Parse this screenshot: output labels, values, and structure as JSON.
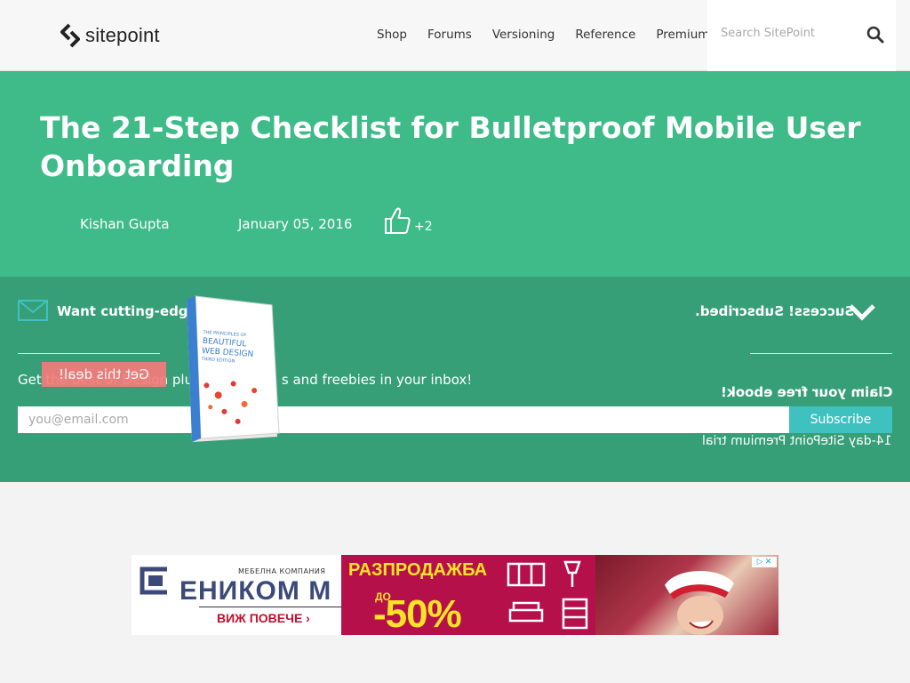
{
  "header": {
    "logo_text": "sitepoint",
    "nav": [
      "Shop",
      "Forums",
      "Versioning",
      "Reference",
      "Premium"
    ],
    "search_placeholder": "Search SitePoint"
  },
  "article": {
    "title": "The 21-Step Checklist for Bulletproof Mobile User Onboarding",
    "author": "Kishan Gupta",
    "date": "January 05, 2016",
    "likes": "+2"
  },
  "newsletter": {
    "heading": "Want cutting-edge",
    "description": "Get the best of Design plus",
    "description_tail": "s and freebies in your inbox!",
    "email_placeholder": "you@email.com",
    "subscribe_label": "Subscribe",
    "success_text": "Success! Subscribed.",
    "claim_text": "Claim your free ebook!",
    "trial_text": "14-day SitePoint Premium trial",
    "deal_label": "Get this deal!",
    "book_title": "THE PRINCIPLES OF BEAUTIFUL WEB DESIGN",
    "book_edition": "THIRD EDITION"
  },
  "ad": {
    "subtitle": "МЕБЕЛНА КОМПАНИЯ",
    "company": "ЕНИКОМ М",
    "more": "ВИЖ ПОВЕЧЕ",
    "sale": "РАЗПРОДАЖБА",
    "up_to": "ДО",
    "discount": "-50%"
  },
  "colors": {
    "hero": "#3fbb89",
    "newsletter": "#369f78",
    "subscribe": "#3fc2bf",
    "deal": "#f47c7c",
    "ad_magenta": "#b6104a",
    "ad_yellow": "#ffe326"
  }
}
